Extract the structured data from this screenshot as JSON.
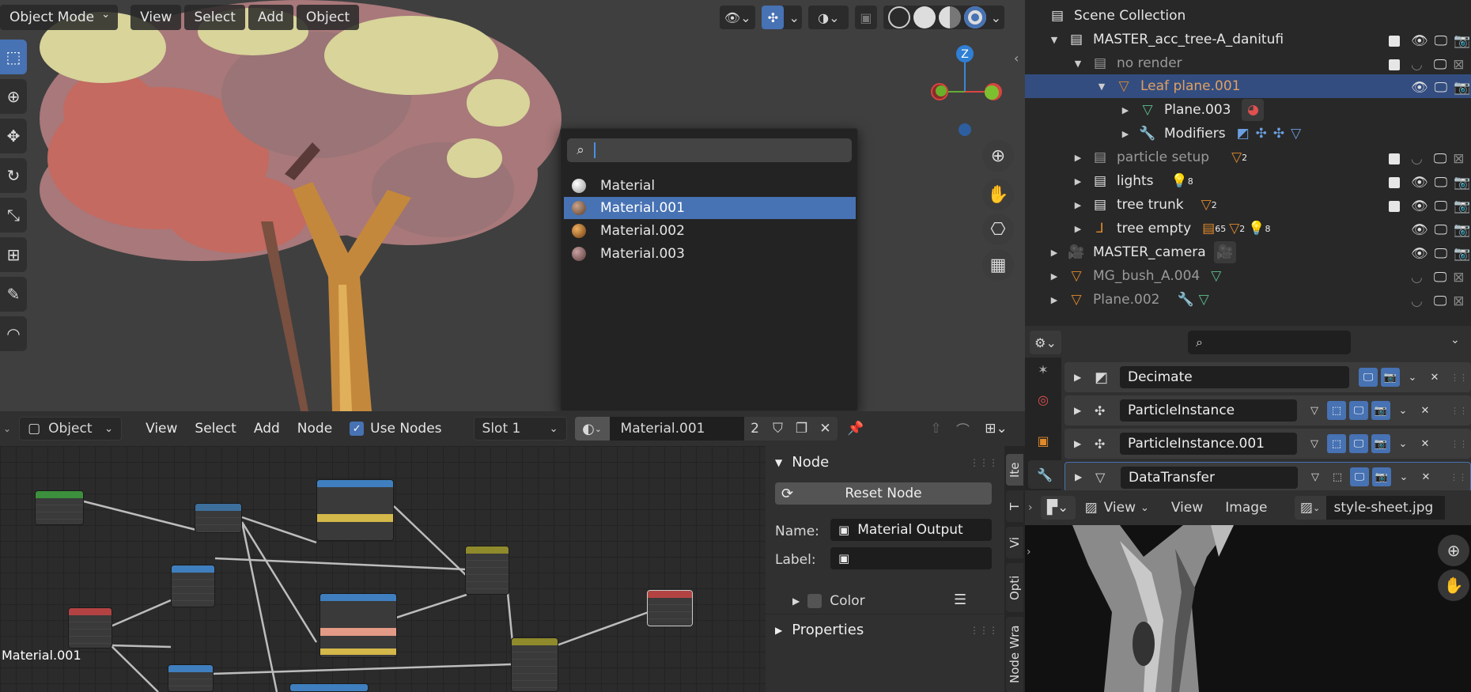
{
  "viewport": {
    "mode": "Object Mode",
    "menus": [
      "View",
      "Select",
      "Add",
      "Object"
    ]
  },
  "material_popup": {
    "search_value": "",
    "items": [
      {
        "name": "Material",
        "color": "#e8e8e8"
      },
      {
        "name": "Material.001",
        "color": "#8a6a56"
      },
      {
        "name": "Material.002",
        "color": "#b07a3a"
      },
      {
        "name": "Material.003",
        "color": "#8a6a66"
      }
    ],
    "selected_index": 1
  },
  "node_editor": {
    "type_label": "Object",
    "menus": [
      "View",
      "Select",
      "Add",
      "Node"
    ],
    "use_nodes_label": "Use Nodes",
    "use_nodes_checked": true,
    "slot": "Slot 1",
    "material_name": "Material.001",
    "user_count": "2",
    "canvas_label": "Material.001"
  },
  "node_panel": {
    "section_title": "Node",
    "reset_label": "Reset Node",
    "name_label": "Name:",
    "name_value": "Material Output",
    "label_label": "Label:",
    "label_value": "",
    "color_label": "Color",
    "properties_label": "Properties",
    "tabs": [
      "Ite",
      "T",
      "Vi",
      "Opti",
      "Node Wra"
    ]
  },
  "outliner": {
    "rows": [
      {
        "label": "Scene Collection",
        "indent": 0,
        "icon": "collection-icon",
        "dim": false
      },
      {
        "label": "MASTER_acc_tree-A_danitufi",
        "indent": 1,
        "icon": "collection-icon",
        "dim": false
      },
      {
        "label": "no render",
        "indent": 2,
        "icon": "collection-icon",
        "dim": true
      },
      {
        "label": "Leaf plane.001",
        "indent": 3,
        "icon": "object-icon",
        "dim": false,
        "selected": true
      },
      {
        "label": "Plane.003",
        "indent": 4,
        "icon": "mesh-icon",
        "dim": false
      },
      {
        "label": "Modifiers",
        "indent": 4,
        "icon": "wrench-icon",
        "dim": false
      },
      {
        "label": "particle setup",
        "indent": 2,
        "icon": "collection-icon",
        "dim": true,
        "badge": "2"
      },
      {
        "label": "lights",
        "indent": 2,
        "icon": "collection-icon",
        "dim": false,
        "badge": "8"
      },
      {
        "label": "tree trunk",
        "indent": 2,
        "icon": "collection-icon",
        "dim": false,
        "badge": "2"
      },
      {
        "label": "tree empty",
        "indent": 2,
        "icon": "empty-icon",
        "dim": false,
        "badge": "65"
      },
      {
        "label": "MASTER_camera",
        "indent": 1,
        "icon": "camera-icon",
        "dim": false
      },
      {
        "label": "MG_bush_A.004",
        "indent": 1,
        "icon": "object-icon",
        "dim": true
      },
      {
        "label": "Plane.002",
        "indent": 1,
        "icon": "object-icon",
        "dim": true
      }
    ],
    "extra_badges": [
      "2",
      "8"
    ]
  },
  "modifiers": {
    "items": [
      "Decimate",
      "ParticleInstance",
      "ParticleInstance.001",
      "DataTransfer"
    ]
  },
  "image_editor": {
    "menus": [
      "View",
      "View",
      "Image"
    ],
    "image_name": "style-sheet.jpg"
  },
  "colors": {
    "accent": "#4772b3",
    "orange": "#e08a2c"
  }
}
